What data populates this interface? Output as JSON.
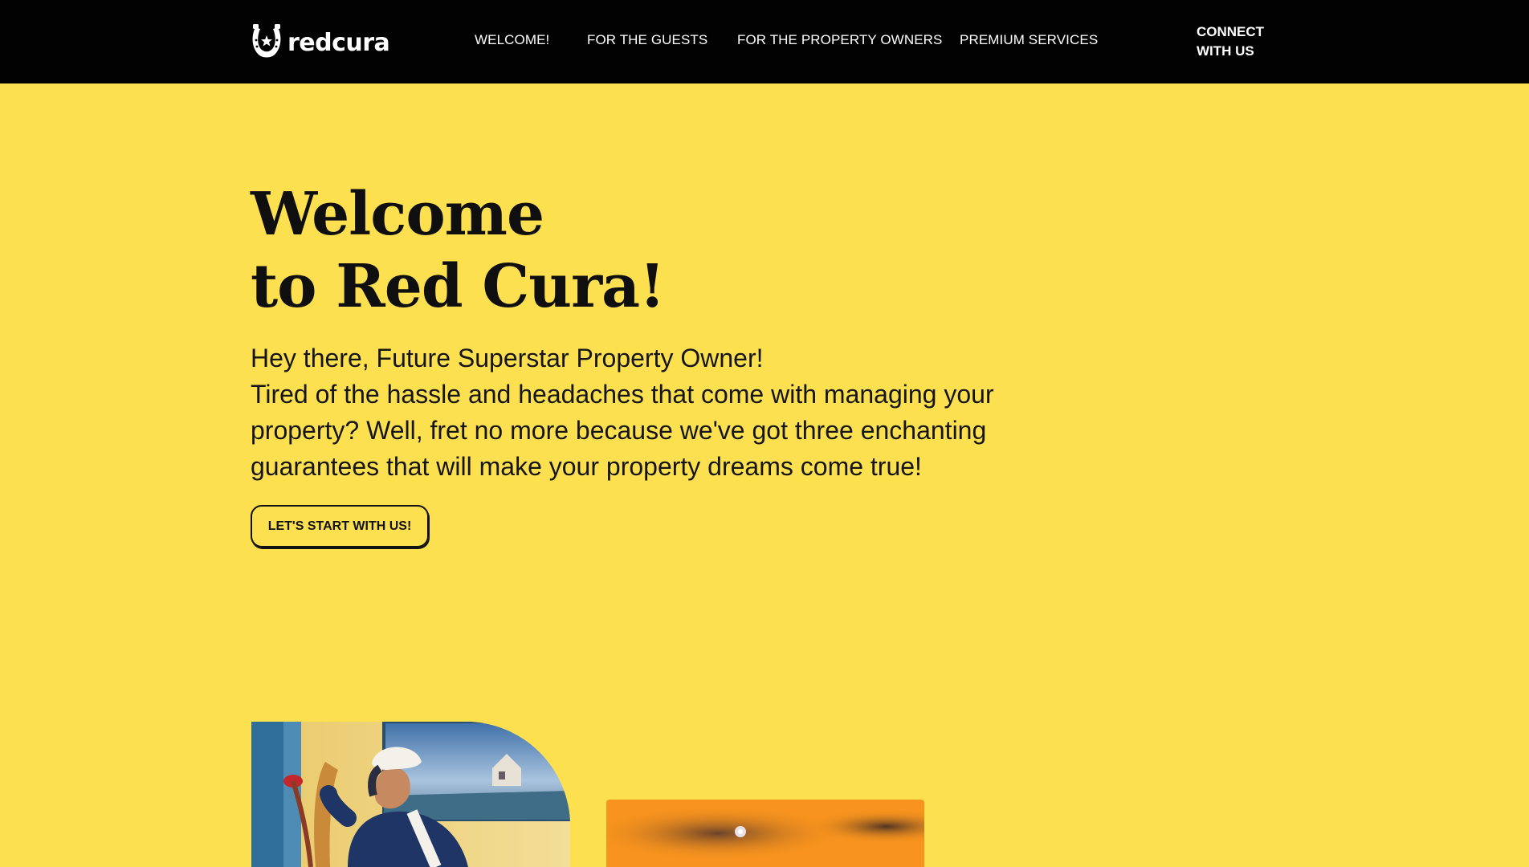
{
  "brand": {
    "name": "redcura",
    "logo_icon": "horseshoe-icon",
    "color": "#FFFFFF"
  },
  "nav": {
    "items": [
      {
        "label": "WELCOME!"
      },
      {
        "label": "FOR THE GUESTS"
      },
      {
        "label": "FOR THE PROPERTY OWNERS"
      },
      {
        "label": "PREMIUM SERVICES"
      }
    ],
    "connect": {
      "line1": "CONNECT",
      "line2": "WITH US"
    }
  },
  "hero": {
    "title_line1": "Welcome",
    "title_line2": "to Red Cura!",
    "paragraph": [
      "Hey there, Future Superstar Property Owner!",
      "Tired of the hassle and headaches that come with managing your",
      "property? Well, fret no more because we've got three enchanting",
      "guarantees that will make your property dreams come true!"
    ],
    "cta_label": "LET'S START WITH US!"
  },
  "colors": {
    "background": "#FDE050",
    "header": "#020202",
    "text": "#111111",
    "accent_orange": "#F7931E"
  }
}
